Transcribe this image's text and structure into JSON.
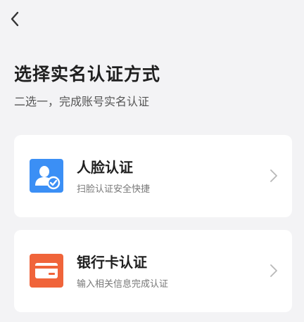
{
  "header": {
    "back_icon": "chevron-left-icon"
  },
  "page": {
    "title": "选择实名认证方式",
    "subtitle": "二选一，完成账号实名认证"
  },
  "options": [
    {
      "title": "人脸认证",
      "description": "扫脸认证安全快捷",
      "icon": "face-verify-icon",
      "icon_color": "#3b8ff5"
    },
    {
      "title": "银行卡认证",
      "description": "输入相关信息完成认证",
      "icon": "bank-card-icon",
      "icon_color": "#f0643a"
    }
  ],
  "colors": {
    "background": "#f3f3f5",
    "card": "#ffffff",
    "chevron": "#b8b8b8"
  }
}
